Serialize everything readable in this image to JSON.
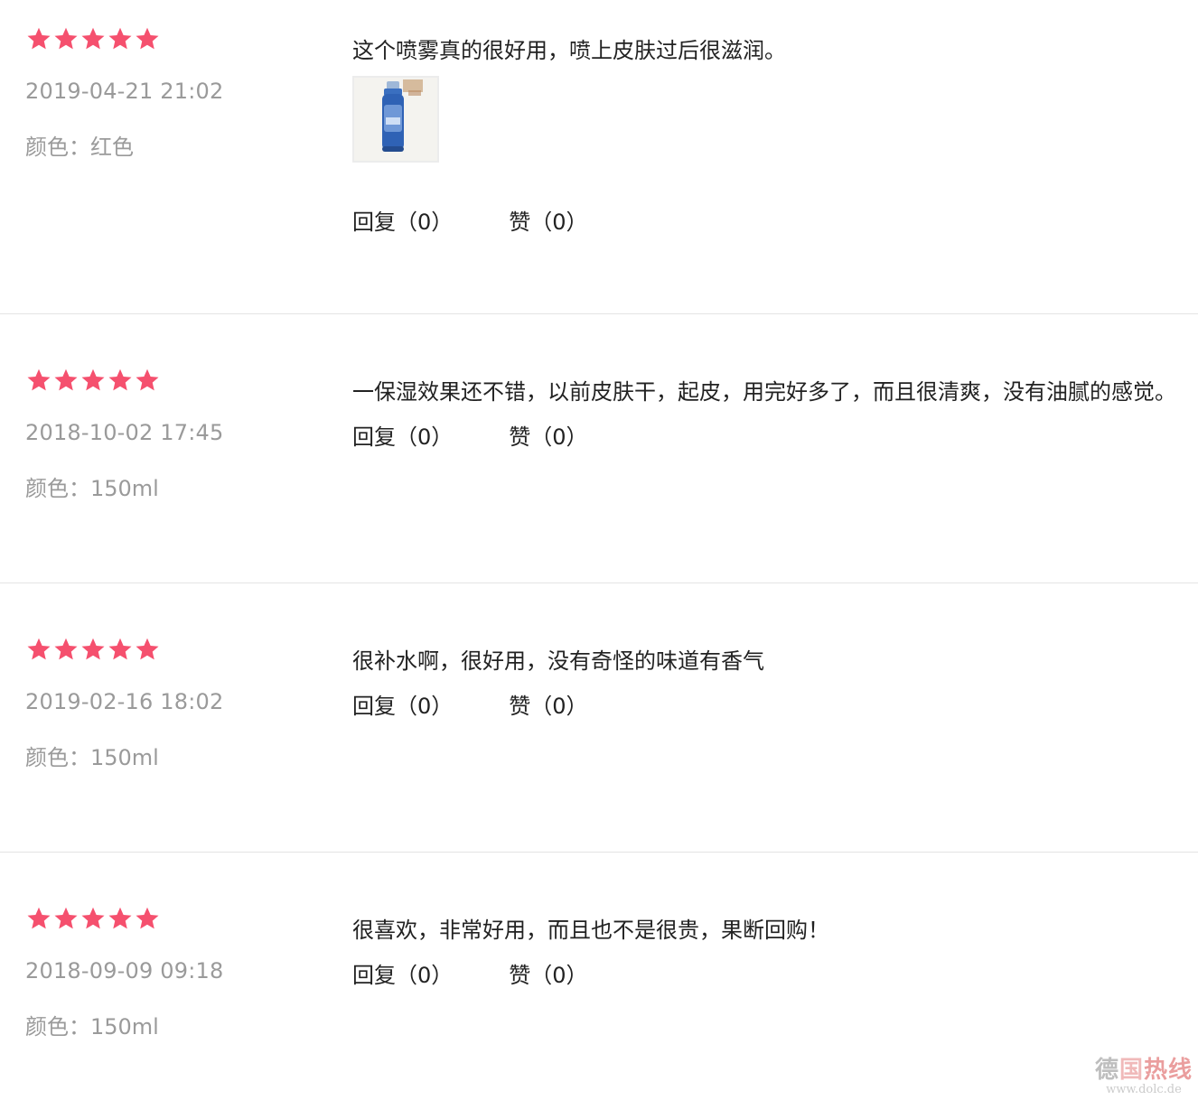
{
  "reviews": [
    {
      "rating": 5,
      "date": "2019-04-21 21:02",
      "spec": "颜色：红色",
      "comment": "这个喷雾真的很好用，喷上皮肤过后很滋润。",
      "has_photo": true,
      "reply": "回复（0）",
      "like": "赞（0）"
    },
    {
      "rating": 5,
      "date": "2018-10-02 17:45",
      "spec": "颜色：150ml",
      "comment": "一保湿效果还不错，以前皮肤干，起皮，用完好多了，而且很清爽，没有油腻的感觉。",
      "has_photo": false,
      "reply": "回复（0）",
      "like": "赞（0）"
    },
    {
      "rating": 5,
      "date": "2019-02-16 18:02",
      "spec": "颜色：150ml",
      "comment": "很补水啊，很好用，没有奇怪的味道有香气",
      "has_photo": false,
      "reply": "回复（0）",
      "like": "赞（0）"
    },
    {
      "rating": 5,
      "date": "2018-09-09 09:18",
      "spec": "颜色：150ml",
      "comment": "很喜欢，非常好用，而且也不是很贵，果断回购！",
      "has_photo": false,
      "reply": "回复（0）",
      "like": "赞（0）"
    }
  ],
  "watermark": {
    "title_part1": "德",
    "title_part2": "国",
    "title_part3": "热线",
    "url": "www.dolc.de"
  },
  "colors": {
    "star": "#f5506e",
    "meta_text": "#9a9a9a",
    "body_text": "#222222",
    "divider": "#e4e4e4"
  }
}
